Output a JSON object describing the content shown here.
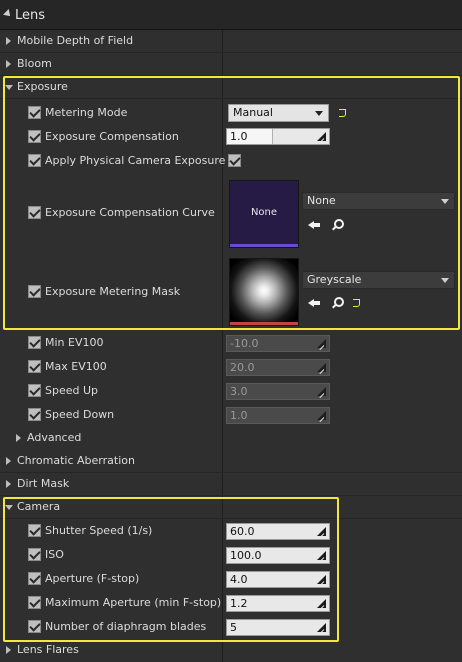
{
  "lens": {
    "title": "Lens"
  },
  "sections": {
    "mobile_dof": "Mobile Depth of Field",
    "bloom": "Bloom",
    "exposure": "Exposure",
    "advanced": "Advanced",
    "chromatic": "Chromatic Aberration",
    "dirt_mask": "Dirt Mask",
    "camera": "Camera",
    "lens_flares": "Lens Flares"
  },
  "exposure": {
    "metering_mode": {
      "label": "Metering Mode",
      "value": "Manual",
      "checked": true
    },
    "compensation": {
      "label": "Exposure Compensation",
      "value": "1.0",
      "slider_fraction": 0.45,
      "checked": true
    },
    "apply_physical": {
      "label": "Apply Physical Camera Exposure",
      "checked": true,
      "value_checked": true
    },
    "comp_curve": {
      "label": "Exposure Compensation Curve",
      "thumb_text": "None",
      "asset": "None",
      "checked": true
    },
    "metering_mask": {
      "label": "Exposure Metering Mask",
      "asset": "Greyscale",
      "checked": true
    },
    "min_ev": {
      "label": "Min EV100",
      "value": "-10.0",
      "checked": true
    },
    "max_ev": {
      "label": "Max EV100",
      "value": "20.0",
      "checked": true
    },
    "speed_up": {
      "label": "Speed Up",
      "value": "3.0",
      "checked": true
    },
    "speed_down": {
      "label": "Speed Down",
      "value": "1.0",
      "checked": true
    }
  },
  "camera": {
    "shutter_speed": {
      "label": "Shutter Speed (1/s)",
      "value": "60.0",
      "checked": true
    },
    "iso": {
      "label": "ISO",
      "value": "100.0",
      "checked": true
    },
    "aperture": {
      "label": "Aperture (F-stop)",
      "value": "4.0",
      "checked": true
    },
    "max_aperture": {
      "label": "Maximum Aperture (min F-stop)",
      "value": "1.2",
      "checked": true
    },
    "blades": {
      "label": "Number of diaphragm blades",
      "value": "5",
      "checked": true
    }
  },
  "icons": [
    "collapse-arrow-icon",
    "expand-arrow-icon",
    "checkbox-icon",
    "reset-to-default-icon",
    "use-selected-asset-icon",
    "browse-asset-icon",
    "dropdown-arrow-icon",
    "numeric-drag-handle-icon"
  ],
  "colors": {
    "highlight": "#f0e840",
    "reset": "#f0e040",
    "curve_thumb": "#261b45",
    "curve_bar": "#6a4bd0",
    "mask_bar": "#c84040"
  }
}
